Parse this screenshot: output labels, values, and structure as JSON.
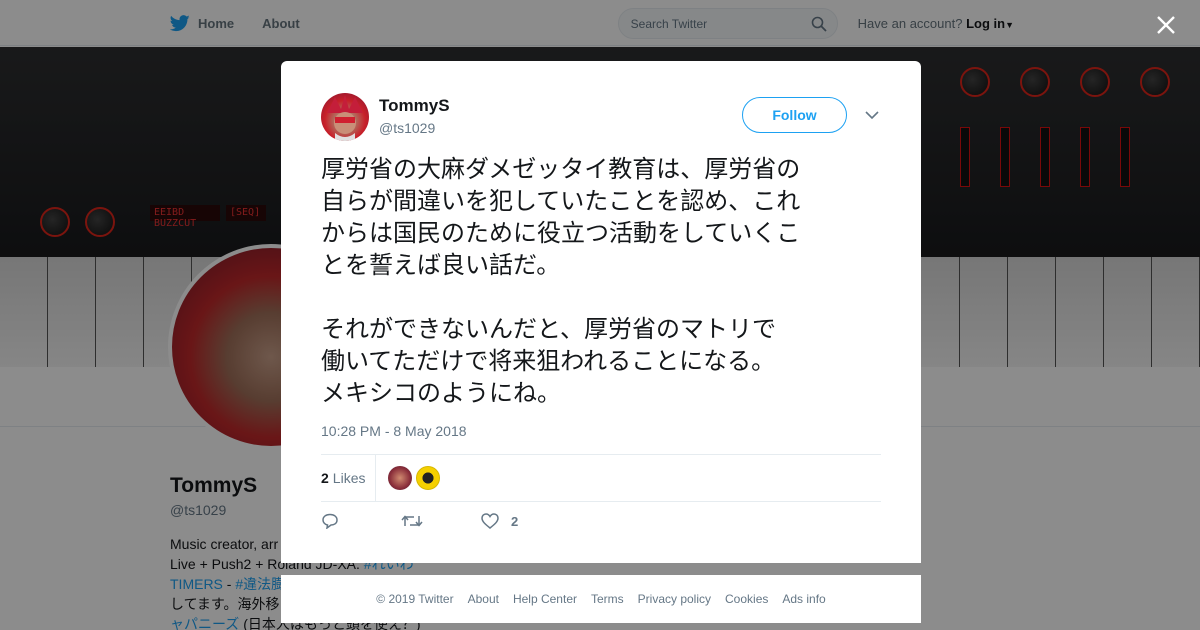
{
  "nav": {
    "home_label": "Home",
    "about_label": "About",
    "search_placeholder": "Search Twitter",
    "have_account_label": "Have an account?",
    "login_label": "Log in"
  },
  "profile": {
    "name": "TommyS",
    "handle": "@ts1029",
    "bio_lines": [
      "Music creator, arr",
      "Live + Push2 + Roland JD-XA.",
      "TIMERS",
      "してます。海外移",
      "ャパニーズ"
    ],
    "bio_hashtag_1": "#れいわ",
    "bio_hashtag_2": "#違法膨",
    "bio_sep": "-",
    "bio_tail": "(日本人はもっと頭を使え？)"
  },
  "tweet": {
    "author_name": "TommyS",
    "author_handle": "@ts1029",
    "follow_label": "Follow",
    "paragraph_1": "厚労省の大麻ダメゼッタイ教育は、厚労省の\n自らが間違いを犯していたことを認め、これ\nからは国民のために役立つ活動をしていくこ\nとを誓えば良い話だ。",
    "paragraph_2": "それができないんだと、厚労省のマトリで\n働いてただけで将来狙われることになる。\nメキシコのようにね。",
    "timestamp": "10:28 PM - 8 May 2018",
    "likes_count": "2",
    "likes_label": "Likes",
    "action_like_count": "2"
  },
  "footer": {
    "links": [
      "© 2019 Twitter",
      "About",
      "Help Center",
      "Terms",
      "Privacy policy",
      "Cookies",
      "Ads info"
    ]
  },
  "banner": {
    "led_1": "EEIBD BUZZCUT",
    "led_2": "[SEQ]"
  },
  "colors": {
    "accent": "#1da1f2",
    "text": "#14171a",
    "muted": "#657786"
  }
}
